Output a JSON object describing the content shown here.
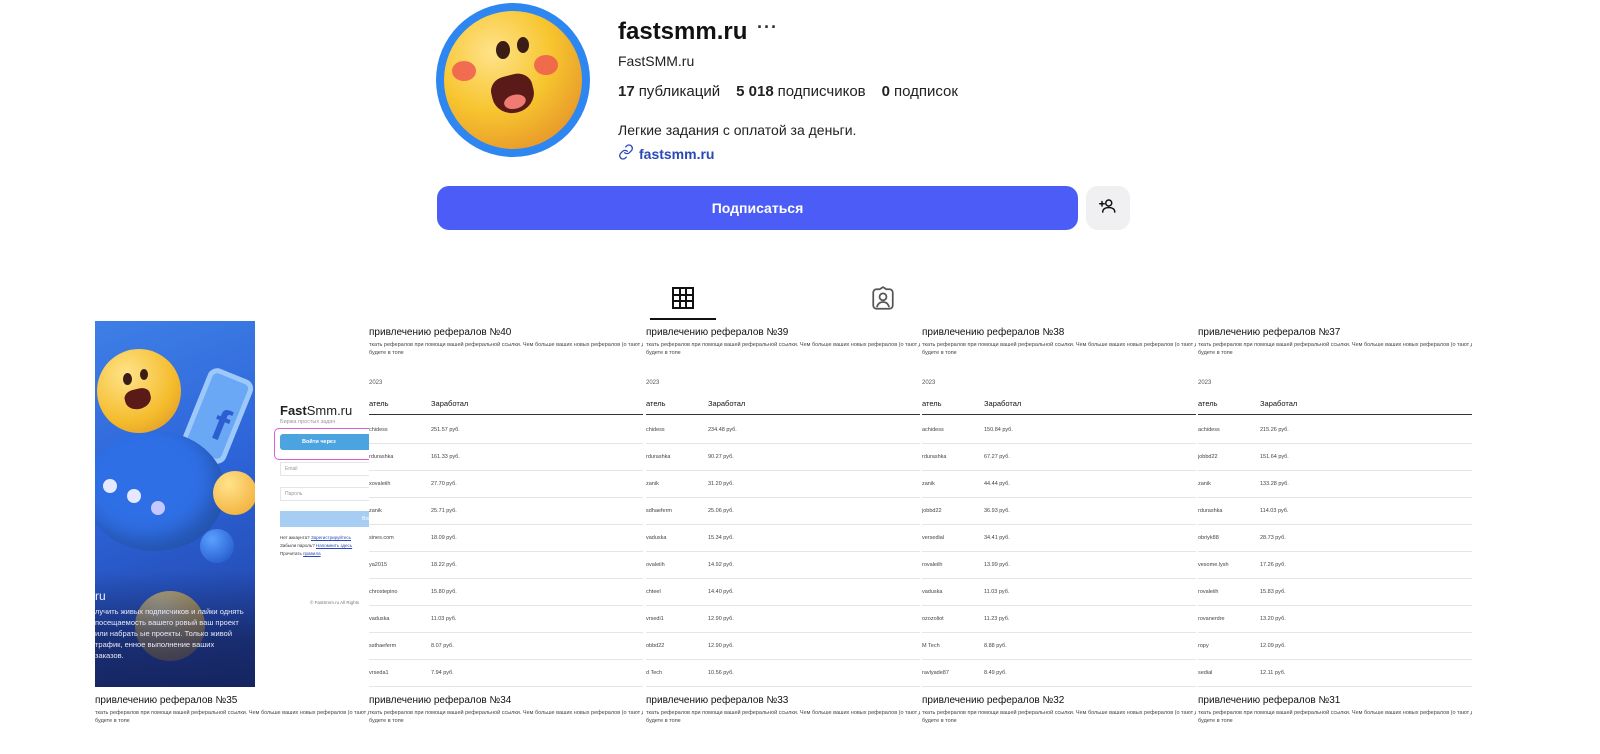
{
  "profile": {
    "username": "fastsmm.ru",
    "more_label": "···",
    "full_name": "FastSMM.ru",
    "stats": {
      "posts_count": "17",
      "posts_label": "публикаций",
      "followers_count": "5 018",
      "followers_label": "подписчиков",
      "following_count": "0",
      "following_label": "подписок"
    },
    "bio": "Легкие задания с оплатой за деньги.",
    "link_text": "fastsmm.ru",
    "subscribe_label": "Подписаться",
    "icons": {
      "link": "link-icon",
      "add_friend": "add-person-icon",
      "grid_tab": "grid-icon",
      "tagged_tab": "tagged-person-icon"
    }
  },
  "colors": {
    "accent": "#4b5df6",
    "avatar_ring": "#2e86f0",
    "link": "#2a48b8"
  },
  "login_promo": {
    "logo_bold": "Fast",
    "logo_rest": "Smm.ru",
    "subtitle": "Биржа простых задач",
    "vk_button": "Войти через",
    "email_placeholder": "Email",
    "password_placeholder": "Пароль",
    "submit_label": "Войти",
    "no_account": "Нет аккаунта?",
    "register_link": "Зарегистрируйтесь",
    "forgot": "Забыли пароль?",
    "restore_link": "Напомнить здесь",
    "read": "Прочитать",
    "rules_link": "правила",
    "copyright": "© FastSmm.ru All Rights",
    "ru_text": "ru",
    "promo_text": "лучить живых подписчиков и лайки однять посещаемость вашего ровый ваш проект или набрать ые проекты. Только живой трафик, енное выполнение ваших заказов."
  },
  "referral_posts": [
    {
      "title": "привлечению рефералов №40",
      "desc": "ткать рефералов при помощи вашей реферальной ссылки. Чем больше ваших новых рефералов (о тают денег, тем выше вы будете в топе",
      "year": "2023",
      "col_user": "атель",
      "col_earned": "Заработал",
      "rows": [
        [
          "chidess",
          "251.57 руб."
        ],
        [
          "rdurashka",
          "161.33 руб."
        ],
        [
          "xovaleiih",
          "27.70 руб."
        ],
        [
          "zanik",
          "25.71 руб."
        ],
        [
          "sines.com",
          "18.09 руб."
        ],
        [
          "ya2015",
          "18.22 руб."
        ],
        [
          "chrostepino",
          "15.80 руб."
        ],
        [
          "vaduska",
          "11.03 руб."
        ],
        [
          "ssthaeferm",
          "8.07 руб."
        ],
        [
          "vrseda1",
          "7.94 руб."
        ]
      ]
    },
    {
      "title": "привлечению рефералов №39",
      "desc": "ткать рефералов при помощи вашей реферальной ссылки. Чем больше ваших новых рефералов (о тают денег, тем выше вы будете в топе",
      "year": "2023",
      "col_user": "атель",
      "col_earned": "Заработал",
      "rows": [
        [
          "chidess",
          "234.48 руб."
        ],
        [
          "rdurashka",
          "90.27 руб."
        ],
        [
          "zanik",
          "31.20 руб."
        ],
        [
          "sdhaeferm",
          "25.06 руб."
        ],
        [
          "vaduska",
          "15.34 руб."
        ],
        [
          "ovaleiih",
          "14.92 руб."
        ],
        [
          "chteel",
          "14.40 руб."
        ],
        [
          "vrsedi1",
          "12.90 руб."
        ],
        [
          "obbd22",
          "12.90 руб."
        ],
        [
          "d Tech",
          "10.56 руб."
        ]
      ]
    },
    {
      "title": "привлечению рефералов №38",
      "desc": "ткать рефералов при помощи вашей реферальной ссылки. Чем больше ваших новых рефералов (о тают денег, тем выше вы будете в топе",
      "year": "2023",
      "col_user": "атель",
      "col_earned": "Заработал",
      "rows": [
        [
          "achidess",
          "150.84 руб."
        ],
        [
          "rdurashka",
          "67.27 руб."
        ],
        [
          "zanik",
          "44.44 руб."
        ],
        [
          "jobbd22",
          "36.93 руб."
        ],
        [
          "versedial",
          "34.41 руб."
        ],
        [
          "rovaleiih",
          "13.99 руб."
        ],
        [
          "vaduska",
          "11.03 руб."
        ],
        [
          "ozozoliot",
          "11.23 руб."
        ],
        [
          "M Tech",
          "8.88 руб."
        ],
        [
          "ravlyade87",
          "8.49 руб."
        ]
      ]
    },
    {
      "title": "привлечению рефералов №37",
      "desc": "ткать рефералов при помощи вашей реферальной ссылки. Чем больше ваших новых рефералов (о тают денег, тем выше вы будете в топе",
      "year": "2023",
      "col_user": "атель",
      "col_earned": "Заработал",
      "rows": [
        [
          "achidess",
          "215.26 руб."
        ],
        [
          "jobbd22",
          "151.64 руб."
        ],
        [
          "zanik",
          "133.28 руб."
        ],
        [
          "rdurashka",
          "114.03 руб."
        ],
        [
          "obriyk88",
          "28.73 руб."
        ],
        [
          "vesome.lysh",
          "17.26 руб."
        ],
        [
          "rovaleiih",
          "15.83 руб."
        ],
        [
          "rovanerdre",
          "13.20 руб."
        ],
        [
          "ropy",
          "12.09 руб."
        ],
        [
          "sedial",
          "12.11 руб."
        ]
      ]
    },
    {
      "title": "привлечению рефералов №35",
      "desc": "ткать рефералов при помощи вашей реферальной ссылки. Чем больше ваших новых рефералов (о тают денег, тем выше вы будете в топе"
    },
    {
      "title": "привлечению рефералов №34",
      "desc": "ткать рефералов при помощи вашей реферальной ссылки. Чем больше ваших новых рефералов (о тают денег, тем выше вы будете в топе"
    },
    {
      "title": "привлечению рефералов №33",
      "desc": "ткать рефералов при помощи вашей реферальной ссылки. Чем больше ваших новых рефералов (о тают денег, тем выше вы будете в топе"
    },
    {
      "title": "привлечению рефералов №32",
      "desc": "ткать рефералов при помощи вашей реферальной ссылки. Чем больше ваших новых рефералов (о тают денег, тем выше вы будете в топе"
    },
    {
      "title": "привлечению рефералов №31",
      "desc": "ткать рефералов при помощи вашей реферальной ссылки. Чем больше ваших новых рефералов (о тают денег, тем выше вы будете в топе"
    }
  ]
}
